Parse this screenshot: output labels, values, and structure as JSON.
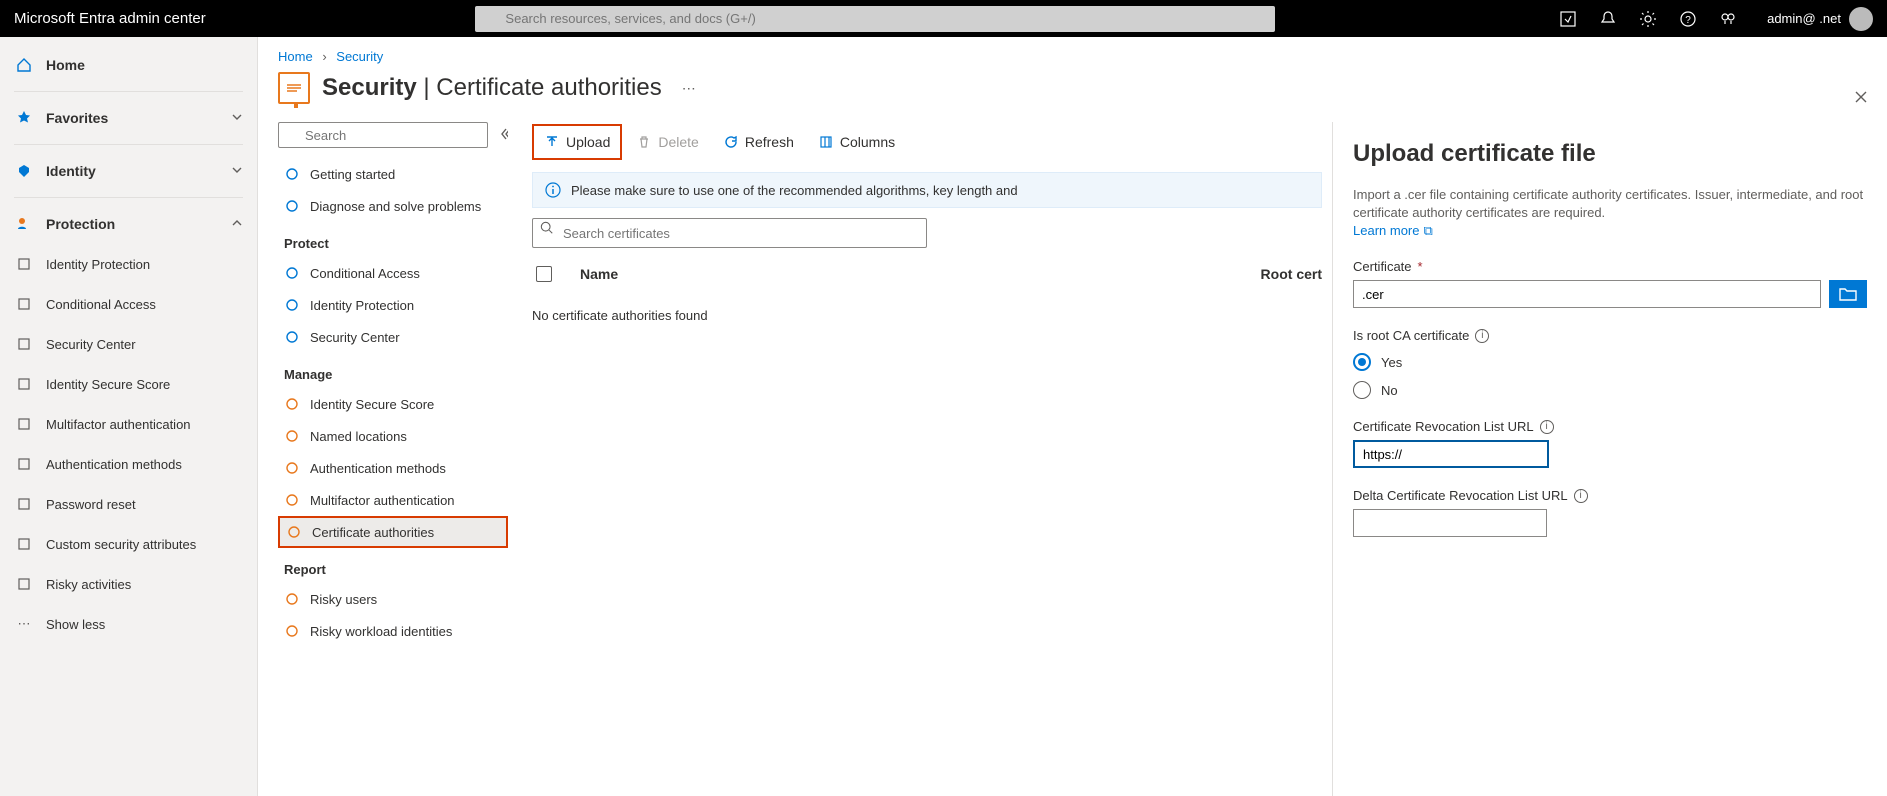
{
  "header": {
    "brand": "Microsoft Entra admin center",
    "search_placeholder": "Search resources, services, and docs (G+/)",
    "account": "admin@ .net"
  },
  "sidebar": {
    "home": "Home",
    "favorites": "Favorites",
    "identity": "Identity",
    "protection": "Protection",
    "protection_items": [
      "Identity Protection",
      "Conditional Access",
      "Security Center",
      "Identity Secure Score",
      "Multifactor authentication",
      "Authentication methods",
      "Password reset",
      "Custom security attributes",
      "Risky activities"
    ],
    "show_less": "Show less"
  },
  "breadcrumb": {
    "home": "Home",
    "security": "Security"
  },
  "page_title": {
    "strong": "Security",
    "sep": " | ",
    "rest": "Certificate authorities"
  },
  "midnav": {
    "search_placeholder": "Search",
    "items_top": [
      "Getting started",
      "Diagnose and solve problems"
    ],
    "group_protect": "Protect",
    "items_protect": [
      "Conditional Access",
      "Identity Protection",
      "Security Center"
    ],
    "group_manage": "Manage",
    "items_manage": [
      "Identity Secure Score",
      "Named locations",
      "Authentication methods",
      "Multifactor authentication",
      "Certificate authorities"
    ],
    "group_report": "Report",
    "items_report": [
      "Risky users",
      "Risky workload identities"
    ]
  },
  "toolbar": {
    "upload": "Upload",
    "delete": "Delete",
    "refresh": "Refresh",
    "columns": "Columns"
  },
  "info_bar": "Please make sure to use one of the recommended algorithms, key length and",
  "cert_search_placeholder": "Search certificates",
  "table": {
    "col_name": "Name",
    "col_root": "Root cert",
    "empty": "No certificate authorities found"
  },
  "flyout": {
    "title": "Upload certificate file",
    "desc": "Import a .cer file containing certificate authority certificates. Issuer, intermediate, and root certificate authority certificates are required.",
    "learn_more": "Learn more",
    "cert_label": "Certificate",
    "cert_value": ".cer",
    "is_root_label": "Is root CA certificate",
    "opt_yes": "Yes",
    "opt_no": "No",
    "crl_label": "Certificate Revocation List URL",
    "crl_value": "https://",
    "delta_label": "Delta Certificate Revocation List URL",
    "delta_value": ""
  }
}
